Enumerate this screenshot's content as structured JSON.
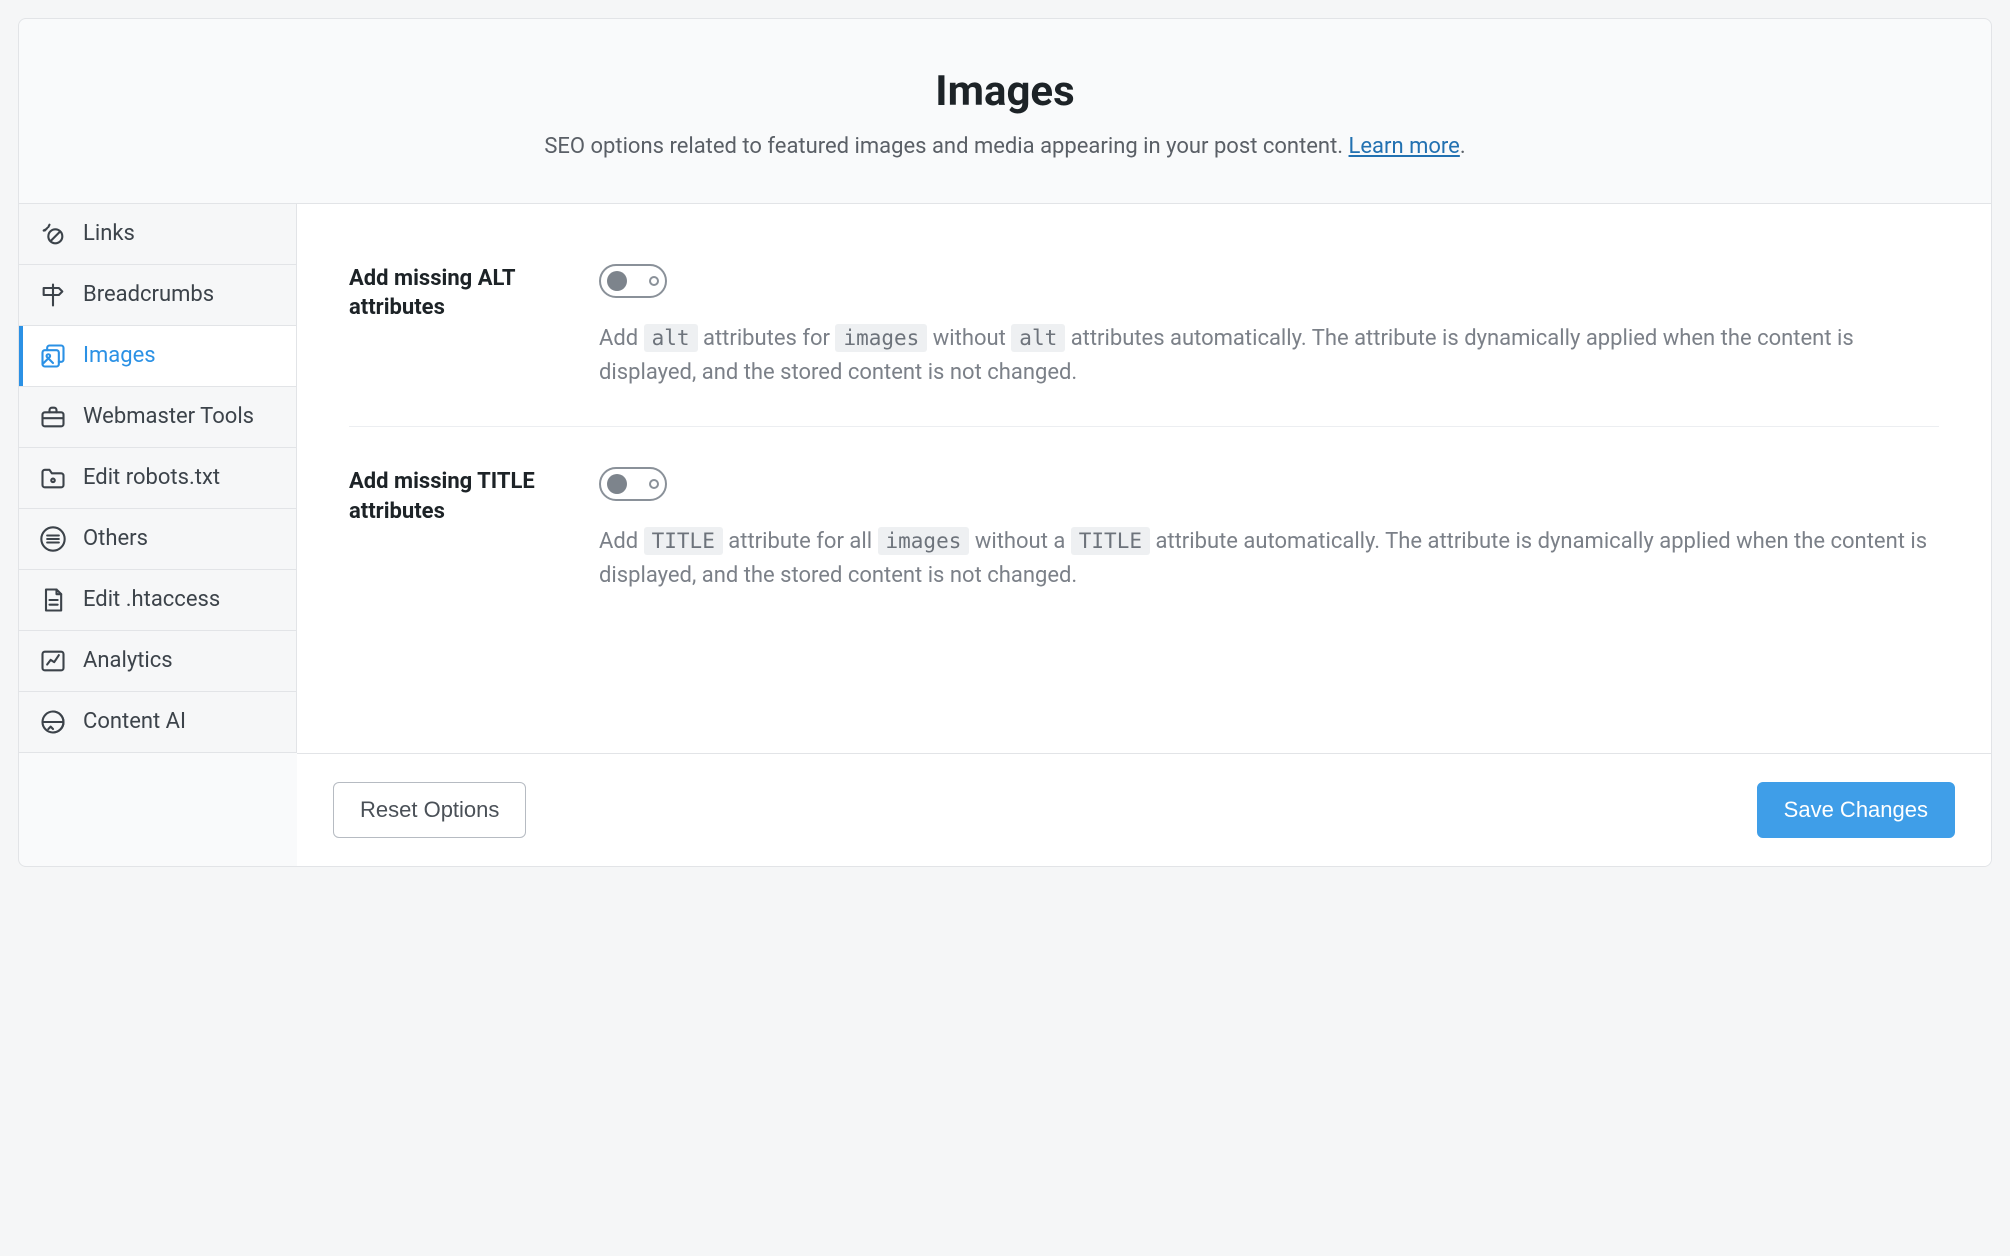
{
  "header": {
    "title": "Images",
    "description_prefix": "SEO options related to featured images and media appearing in your post content. ",
    "learn_more": "Learn more",
    "description_suffix": "."
  },
  "sidebar": {
    "items": [
      {
        "key": "links",
        "label": "Links"
      },
      {
        "key": "breadcrumbs",
        "label": "Breadcrumbs"
      },
      {
        "key": "images",
        "label": "Images"
      },
      {
        "key": "webmaster-tools",
        "label": "Webmaster Tools"
      },
      {
        "key": "edit-robots",
        "label": "Edit robots.txt"
      },
      {
        "key": "others",
        "label": "Others"
      },
      {
        "key": "edit-htaccess",
        "label": "Edit .htaccess"
      },
      {
        "key": "analytics",
        "label": "Analytics"
      },
      {
        "key": "content-ai",
        "label": "Content AI"
      }
    ],
    "active": "images"
  },
  "settings": {
    "alt": {
      "label": "Add missing ALT attributes",
      "value": false,
      "desc": {
        "p1": "Add ",
        "c1": "alt",
        "p2": " attributes for ",
        "c2": "images",
        "p3": " without ",
        "c3": "alt",
        "p4": " attributes automatically. The attribute is dynamically applied when the content is displayed, and the stored content is not changed."
      }
    },
    "title": {
      "label": "Add missing TITLE attributes",
      "value": false,
      "desc": {
        "p1": "Add ",
        "c1": "TITLE",
        "p2": " attribute for all ",
        "c2": "images",
        "p3": " without a ",
        "c3": "TITLE",
        "p4": " attribute automatically. The attribute is dynamically applied when the content is displayed, and the stored content is not changed."
      }
    }
  },
  "footer": {
    "reset": "Reset Options",
    "save": "Save Changes"
  }
}
